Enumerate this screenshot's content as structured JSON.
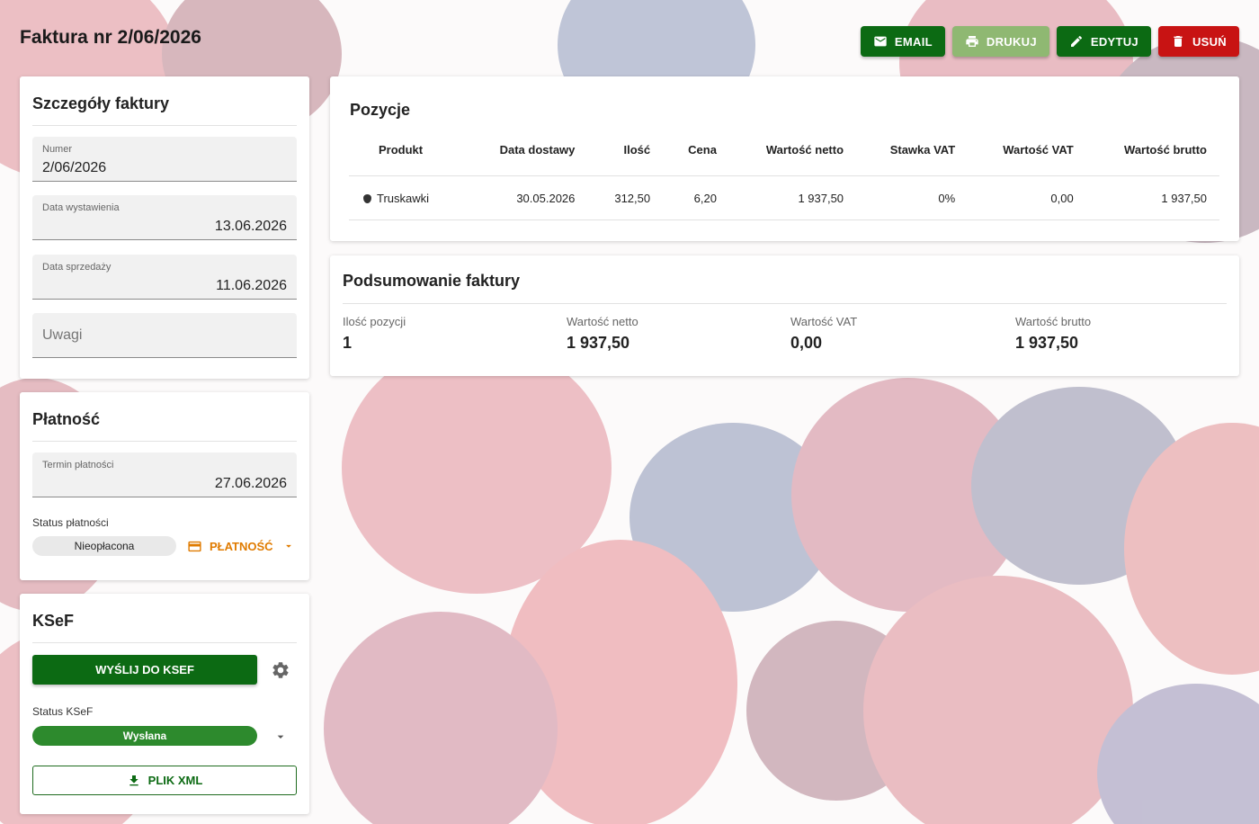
{
  "page": {
    "title": "Faktura nr 2/06/2026"
  },
  "actions": {
    "email": "EMAIL",
    "print": "DRUKUJ",
    "edit": "EDYTUJ",
    "delete": "USUŃ"
  },
  "details": {
    "title": "Szczegóły faktury",
    "number_label": "Numer",
    "number_value": "2/06/2026",
    "issue_label": "Data wystawienia",
    "issue_value": "13.06.2026",
    "sale_label": "Data sprzedaży",
    "sale_value": "11.06.2026",
    "notes_placeholder": "Uwagi"
  },
  "payment": {
    "title": "Płatność",
    "due_label": "Termin płatności",
    "due_value": "27.06.2026",
    "status_label": "Status płatności",
    "status_value": "Nieopłacona",
    "button": "PŁATNOŚĆ"
  },
  "ksef": {
    "title": "KSeF",
    "send_button": "WYŚLIJ DO KSEF",
    "status_label": "Status KSeF",
    "status_value": "Wysłana",
    "xml_button": "PLIK XML"
  },
  "positions": {
    "title": "Pozycje",
    "headers": [
      "Produkt",
      "Data dostawy",
      "Ilość",
      "Cena",
      "Wartość netto",
      "Stawka VAT",
      "Wartość VAT",
      "Wartość brutto"
    ],
    "rows": [
      {
        "product": "Truskawki",
        "product_icon": "strawberry-icon",
        "delivery": "30.05.2026",
        "qty": "312,50",
        "price": "6,20",
        "net": "1 937,50",
        "vat_rate": "0%",
        "vat": "0,00",
        "gross": "1 937,50"
      }
    ]
  },
  "summary": {
    "title": "Podsumowanie faktury",
    "count_label": "Ilość pozycji",
    "count_value": "1",
    "net_label": "Wartość netto",
    "net_value": "1 937,50",
    "vat_label": "Wartość VAT",
    "vat_value": "0,00",
    "gross_label": "Wartość brutto",
    "gross_value": "1 937,50"
  },
  "colors": {
    "primary": "#0c6a13",
    "print": "#8fb872",
    "danger": "#c81313",
    "payment_accent": "#e07b00",
    "ksef_status": "#2d8a2d"
  }
}
